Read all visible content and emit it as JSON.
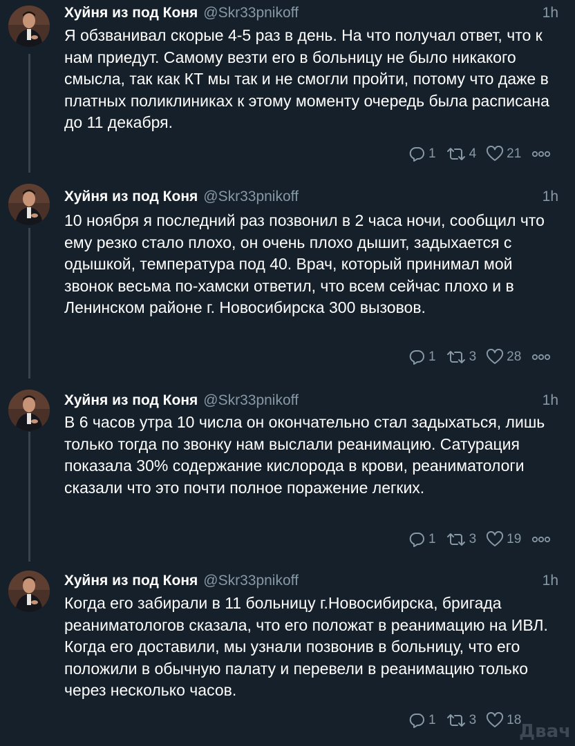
{
  "author": {
    "name": "Хуйня из под Коня",
    "handle": "@Skr33pnikoff"
  },
  "tweets": [
    {
      "time": "1h",
      "text": "Я обзванивал скорые 4-5 раз в день. На что получал ответ, что к нам приедут. Самому везти его в больницу не было никакого смысла, так как КТ мы так и не смогли пройти, потому что даже в платных поликлиниках к этому моменту очередь была расписана до 11 декабря.",
      "replies": "1",
      "retweets": "4",
      "likes": "21"
    },
    {
      "time": "1h",
      "text": "10 ноября я последний раз позвонил в 2 часа ночи, сообщил что ему резко стало плохо, он очень плохо дышит, задыхается с одышкой, температура под 40. Врач, который принимал мой звонок весьма по-хамски ответил, что всем сейчас плохо и в Ленинском районе г. Новосибирска 300 вызовов.",
      "replies": "1",
      "retweets": "3",
      "likes": "28"
    },
    {
      "time": "1h",
      "text": "В 6 часов утра 10 числа он окончательно стал задыхаться, лишь только тогда по звонку нам выслали реанимацию. Сатурация показала 30% содержание кислорода в крови, реаниматологи сказали что это почти полное поражение легких.",
      "replies": "1",
      "retweets": "3",
      "likes": "19"
    },
    {
      "time": "1h",
      "text": "Когда его забирали в 11 больницу г.Новосибирска, бригада реаниматологов сказала, что его положат в реанимацию на ИВЛ. Когда его доставили, мы узнали позвонив в больницу, что его положили в обычную палату и перевели в реанимацию только через несколько часов.",
      "replies": "1",
      "retweets": "3",
      "likes": "18"
    }
  ],
  "watermark": "Двач",
  "icons": {
    "reply": "reply-icon",
    "retweet": "retweet-icon",
    "like": "heart-icon",
    "more": "more-icon"
  },
  "colors": {
    "background": "#15202b",
    "secondary_text": "#8899a6",
    "thread_line": "#38444d"
  }
}
